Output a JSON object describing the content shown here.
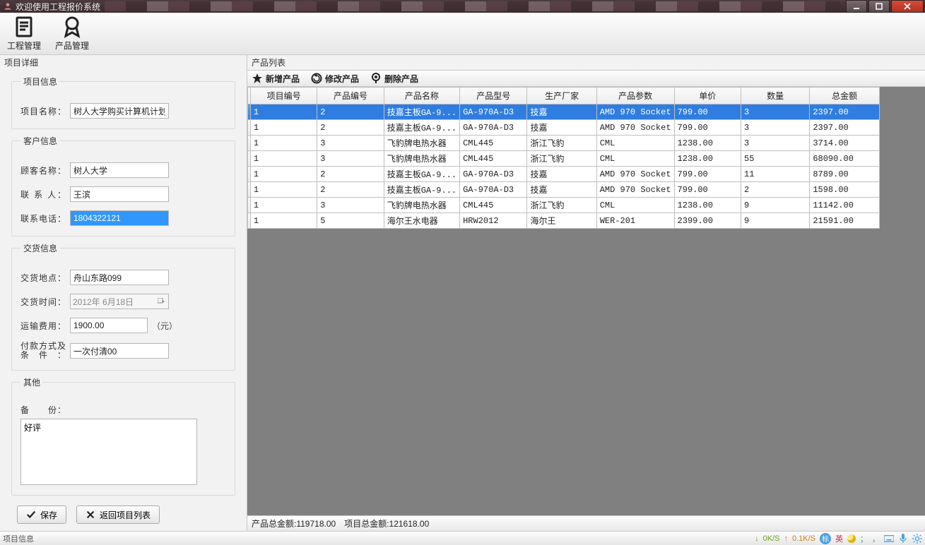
{
  "window": {
    "title": "欢迎使用工程报价系统"
  },
  "toolbar": {
    "project_mgmt": "工程管理",
    "product_mgmt": "产品管理"
  },
  "left": {
    "title": "项目详细",
    "group_project": {
      "legend": "项目信息",
      "name_label": "项目名称：",
      "name_value": "树人大学购买计算机计划"
    },
    "group_customer": {
      "legend": "客户信息",
      "cust_label": "顾客名称：",
      "cust_value": "树人大学",
      "contact_label": "联 系 人：",
      "contact_value": "王滨",
      "phone_label": "联系电话：",
      "phone_value": "1804322121"
    },
    "group_delivery": {
      "legend": "交货信息",
      "addr_label": "交货地点：",
      "addr_value": "舟山东路099",
      "time_label": "交货时间：",
      "time_value": "2012年 6月18日",
      "ship_label": "运输费用：",
      "ship_value": "1900.00",
      "ship_unit": "（元）",
      "pay_label": "付款方式及条件：",
      "pay_value": "一次付清00"
    },
    "group_other": {
      "legend": "其他",
      "remark_label": "备　　份：",
      "remark_value": "好评"
    },
    "buttons": {
      "save": "保存",
      "back": "返回项目列表"
    }
  },
  "right": {
    "title": "产品列表",
    "toolbar": {
      "add": "新增产品",
      "edit": "修改产品",
      "del": "删除产品"
    },
    "columns": [
      "项目编号",
      "产品编号",
      "产品名称",
      "产品型号",
      "生产厂家",
      "产品参数",
      "单价",
      "数量",
      "总金额"
    ],
    "rows": [
      [
        "1",
        "2",
        "技嘉主板GA-9...",
        "GA-970A-D3",
        "技嘉",
        "AMD 970 Socket",
        "799.00",
        "3",
        "2397.00"
      ],
      [
        "1",
        "2",
        "技嘉主板GA-9...",
        "GA-970A-D3",
        "技嘉",
        "AMD 970 Socket",
        "799.00",
        "3",
        "2397.00"
      ],
      [
        "1",
        "3",
        "飞豹牌电热水器",
        "CML445",
        "浙江飞豹",
        "CML",
        "1238.00",
        "3",
        "3714.00"
      ],
      [
        "1",
        "3",
        "飞豹牌电热水器",
        "CML445",
        "浙江飞豹",
        "CML",
        "1238.00",
        "55",
        "68090.00"
      ],
      [
        "1",
        "2",
        "技嘉主板GA-9...",
        "GA-970A-D3",
        "技嘉",
        "AMD 970 Socket",
        "799.00",
        "11",
        "8789.00"
      ],
      [
        "1",
        "2",
        "技嘉主板GA-9...",
        "GA-970A-D3",
        "技嘉",
        "AMD 970 Socket",
        "799.00",
        "2",
        "1598.00"
      ],
      [
        "1",
        "3",
        "飞豹牌电热水器",
        "CML445",
        "浙江飞豹",
        "CML",
        "1238.00",
        "9",
        "11142.00"
      ],
      [
        "1",
        "5",
        "海尔王水电器",
        "HRW2012",
        "海尔王",
        "WER-201",
        "2399.00",
        "9",
        "21591.00"
      ]
    ],
    "footer": {
      "product_total_label": "产品总金额:",
      "product_total": "119718.00",
      "project_total_label": "项目总金额:",
      "project_total": "121618.00"
    }
  },
  "status": {
    "left": "项目信息",
    "down": "0K/S",
    "up": "0.1K/S",
    "ime": "标",
    "ime2": "英",
    "punct": "；",
    "comma": "，"
  }
}
